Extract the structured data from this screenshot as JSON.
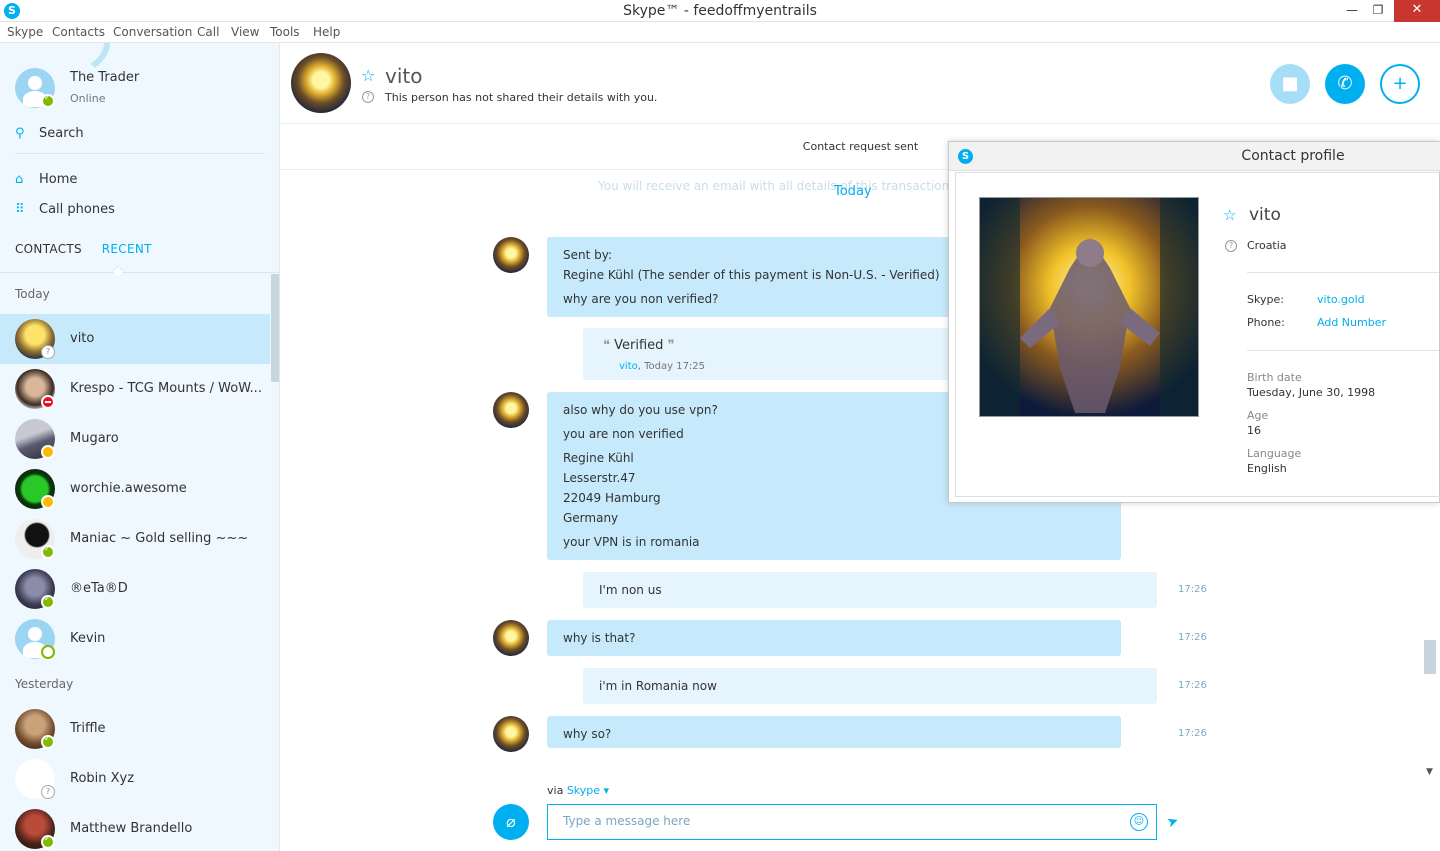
{
  "window": {
    "title": "Skype™ - feedoffmyentrails"
  },
  "menu": [
    "Skype",
    "Contacts",
    "Conversation",
    "Call",
    "View",
    "Tools",
    "Help"
  ],
  "me": {
    "name": "The Trader",
    "status": "Online"
  },
  "sidebar": {
    "search": "Search",
    "home": "Home",
    "call_phones": "Call phones",
    "tab_contacts": "CONTACTS",
    "tab_recent": "RECENT",
    "section_today": "Today",
    "section_yesterday": "Yesterday",
    "contacts": [
      {
        "name": "vito",
        "status": "unknown"
      },
      {
        "name": "Krespo - TCG Mounts / WoW...",
        "status": "dnd"
      },
      {
        "name": "Mugaro",
        "status": "away"
      },
      {
        "name": "worchie.awesome",
        "status": "away"
      },
      {
        "name": "Maniac ~ Gold selling  ~~~",
        "status": "online"
      },
      {
        "name": "®eTa®D",
        "status": "online"
      },
      {
        "name": "Kevin",
        "status": "offline"
      },
      {
        "name": "Triffle",
        "status": "online"
      },
      {
        "name": "Robin Xyz",
        "status": "unknown"
      },
      {
        "name": "Matthew Brandello",
        "status": "online"
      }
    ]
  },
  "header": {
    "name": "vito",
    "subtitle": "This person has not shared their details with you."
  },
  "conversation": {
    "request_sent": "Contact request sent",
    "faded_text": "You will receive an email with all details of this transaction.",
    "day": "Today",
    "msg1": [
      "Sent by:",
      "Regine Kühl (The sender of this payment is Non-U.S. - Verified)",
      "why are you non verified?"
    ],
    "quote_text": "Verified",
    "quote_author": "vito",
    "quote_time": ", Today 17:25",
    "msg2": [
      "also why do you use vpn?",
      "you are non verified",
      "Regine Kühl",
      "Lesserstr.47",
      "22049 Hamburg",
      "Germany",
      "your VPN is in romania"
    ],
    "msg3": "I'm non us",
    "msg4": "why is that?",
    "msg5": "i'm in Romania now",
    "msg6": "why so?",
    "ts": "17:26",
    "via_label": "via",
    "via_service": "Skype",
    "input_placeholder": "Type a message here"
  },
  "profile": {
    "title": "Contact profile",
    "name": "vito",
    "country": "Croatia",
    "skype_label": "Skype:",
    "skype_value": "vito.gold",
    "phone_label": "Phone:",
    "phone_value": "Add Number",
    "birth_label": "Birth date",
    "birth_value": "Tuesday, June 30, 1998",
    "age_label": "Age",
    "age_value": "16",
    "language_label": "Language",
    "language_value": "English"
  },
  "colors": {
    "accent": "#00aff0",
    "selected": "#c6e9fb",
    "online": "#7fba00",
    "away": "#fdb900",
    "dnd": "#e81123"
  }
}
